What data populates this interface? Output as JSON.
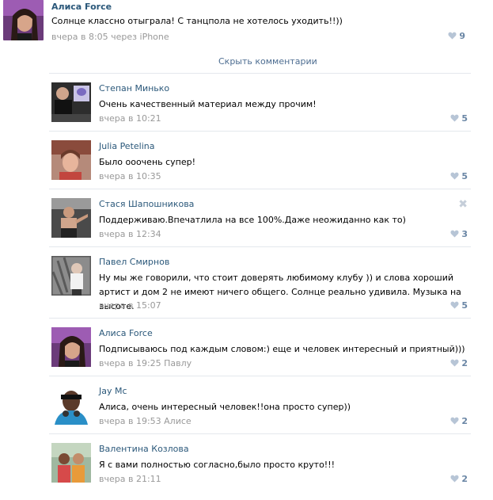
{
  "post": {
    "author": "Алиса Force",
    "text": "Солнце классно отыграла! С танцпола не хотелось уходить!!))",
    "meta": "вчера в 8:05 через iPhone",
    "likes": "9"
  },
  "hide_comments_label": "Скрыть комментарии",
  "comments": [
    {
      "author": "Степан Минько",
      "text": "Очень качественный материал между прочим!",
      "meta": "вчера в 10:21",
      "likes": "5"
    },
    {
      "author": "Julia Petelina",
      "text": "Было ооочень супер!",
      "meta": "вчера в 10:35",
      "likes": "5"
    },
    {
      "author": "Стася Шапошникова",
      "text": "Поддерживаю.Впечатлила на все 100%.Даже неожиданно как то)",
      "meta": "вчера в 12:34",
      "likes": "3"
    },
    {
      "author": "Павел Смирнов",
      "text": "Ну мы же говорили, что стоит доверять любимому клубу )) и слова хороший артист и дом 2 не имеют ничего общего. Солнце реально удивила. Музыка на высоте.",
      "meta": "вчера в 15:07",
      "likes": "5"
    },
    {
      "author": "Алиса Force",
      "text": "Подписываюсь под каждым словом:) еще и человек интересный и приятный)))",
      "meta": "вчера в 19:25 Павлу",
      "likes": "2"
    },
    {
      "author": "Jay Mc",
      "text": "Алиса, очень интересный человек!!она просто супер))",
      "meta": "вчера в 19:53 Алисе",
      "likes": "2"
    },
    {
      "author": "Валентина Козлова",
      "text": "Я с вами полностью согласно,было просто круто!!!",
      "meta": "вчера в 21:11",
      "likes": "2"
    }
  ],
  "delete_symbol": "✖",
  "colors": {
    "link": "#2b587a",
    "meta": "#999999",
    "like": "#6a86a5",
    "divider": "#e4e8ed"
  },
  "icons": {
    "like": "heart-icon",
    "delete": "close-icon"
  }
}
